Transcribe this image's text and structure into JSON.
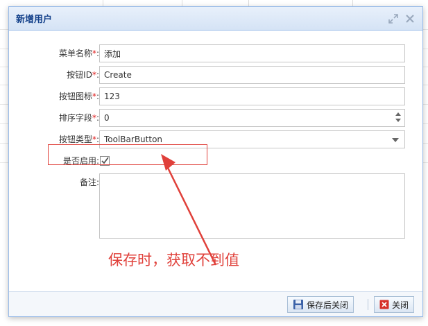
{
  "dialog": {
    "title": "新增用户",
    "maximize_icon": "maximize-icon",
    "close_icon": "close-icon"
  },
  "form": {
    "menu_name": {
      "label": "菜单名称",
      "required_mark": "*",
      "colon": ":",
      "value": "添加"
    },
    "button_id": {
      "label": "按钮ID",
      "required_mark": "*",
      "colon": ":",
      "value": "Create"
    },
    "button_icon": {
      "label": "按钮图标",
      "required_mark": "*",
      "colon": ":",
      "value": "123"
    },
    "sort_field": {
      "label": "排序字段",
      "required_mark": "*",
      "colon": ":",
      "value": "0"
    },
    "button_type": {
      "label": "按钮类型",
      "required_mark": "*",
      "colon": ":",
      "value": "ToolBarButton"
    },
    "enabled": {
      "label": "是否启用",
      "colon": ":",
      "checked": true
    },
    "remark": {
      "label": "备注",
      "colon": ":",
      "value": ""
    }
  },
  "annotation": {
    "text": "保存时，获取不到值",
    "color": "#e0403a"
  },
  "footer": {
    "save_close_label": "保存后关闭",
    "close_label": "关闭"
  },
  "colors": {
    "title_text": "#15428b",
    "border": "#99bbe8",
    "required": "#e02020"
  }
}
